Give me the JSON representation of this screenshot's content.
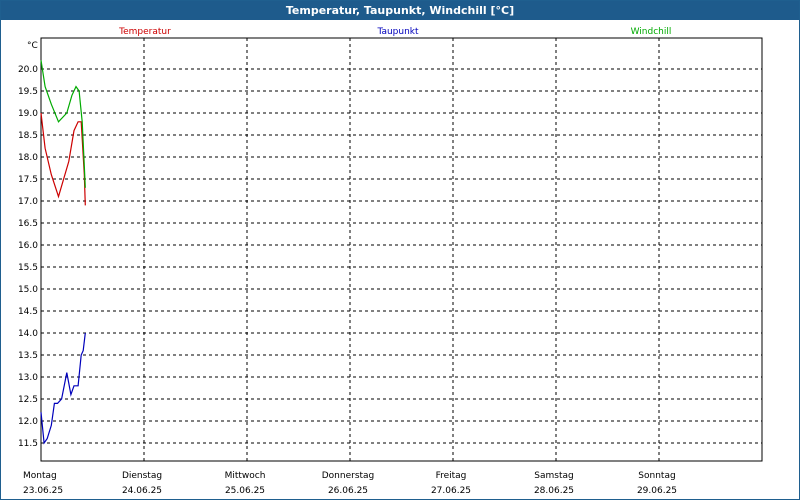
{
  "window": {
    "title": "Temperatur, Taupunkt, Windchill [°C]"
  },
  "chart_data": {
    "type": "line",
    "title": "Temperatur, Taupunkt, Windchill [°C]",
    "ylabel": "°C",
    "ylim": [
      11.1,
      20.4
    ],
    "yticks": [
      "20.0",
      "19.5",
      "19.0",
      "18.5",
      "18.0",
      "17.5",
      "17.0",
      "16.5",
      "16.0",
      "15.5",
      "15.0",
      "14.5",
      "14.0",
      "13.5",
      "13.0",
      "12.5",
      "12.0",
      "11.5"
    ],
    "xlim": [
      0,
      7
    ],
    "days": [
      {
        "weekday": "Montag",
        "date": "23.06.25"
      },
      {
        "weekday": "Dienstag",
        "date": "24.06.25"
      },
      {
        "weekday": "Mittwoch",
        "date": "25.06.25"
      },
      {
        "weekday": "Donnerstag",
        "date": "26.06.25"
      },
      {
        "weekday": "Freitag",
        "date": "27.06.25"
      },
      {
        "weekday": "Samstag",
        "date": "28.06.25"
      },
      {
        "weekday": "Sonntag",
        "date": "29.06.25"
      }
    ],
    "grid": true,
    "legend_placement": "top",
    "series": [
      {
        "name": "Temperatur",
        "color": "#cc0000",
        "x": [
          0.0,
          0.04,
          0.1,
          0.17,
          0.27,
          0.32,
          0.36,
          0.39,
          0.42,
          0.43
        ],
        "y": [
          19.0,
          18.2,
          17.6,
          17.1,
          17.9,
          18.6,
          18.8,
          18.8,
          17.6,
          16.9
        ]
      },
      {
        "name": "Taupunkt",
        "color": "#0000bb",
        "x": [
          0.0,
          0.03,
          0.06,
          0.1,
          0.13,
          0.16,
          0.2,
          0.25,
          0.29,
          0.32,
          0.36,
          0.39,
          0.41,
          0.43
        ],
        "y": [
          12.2,
          11.5,
          11.6,
          11.9,
          12.4,
          12.4,
          12.5,
          13.1,
          12.6,
          12.8,
          12.8,
          13.5,
          13.6,
          14.0
        ]
      },
      {
        "name": "Windchill",
        "color": "#00aa00",
        "x": [
          0.0,
          0.04,
          0.1,
          0.17,
          0.25,
          0.3,
          0.34,
          0.37,
          0.4,
          0.42,
          0.43
        ],
        "y": [
          20.2,
          19.6,
          19.2,
          18.8,
          19.0,
          19.4,
          19.6,
          19.5,
          18.8,
          17.8,
          17.3
        ]
      }
    ]
  }
}
